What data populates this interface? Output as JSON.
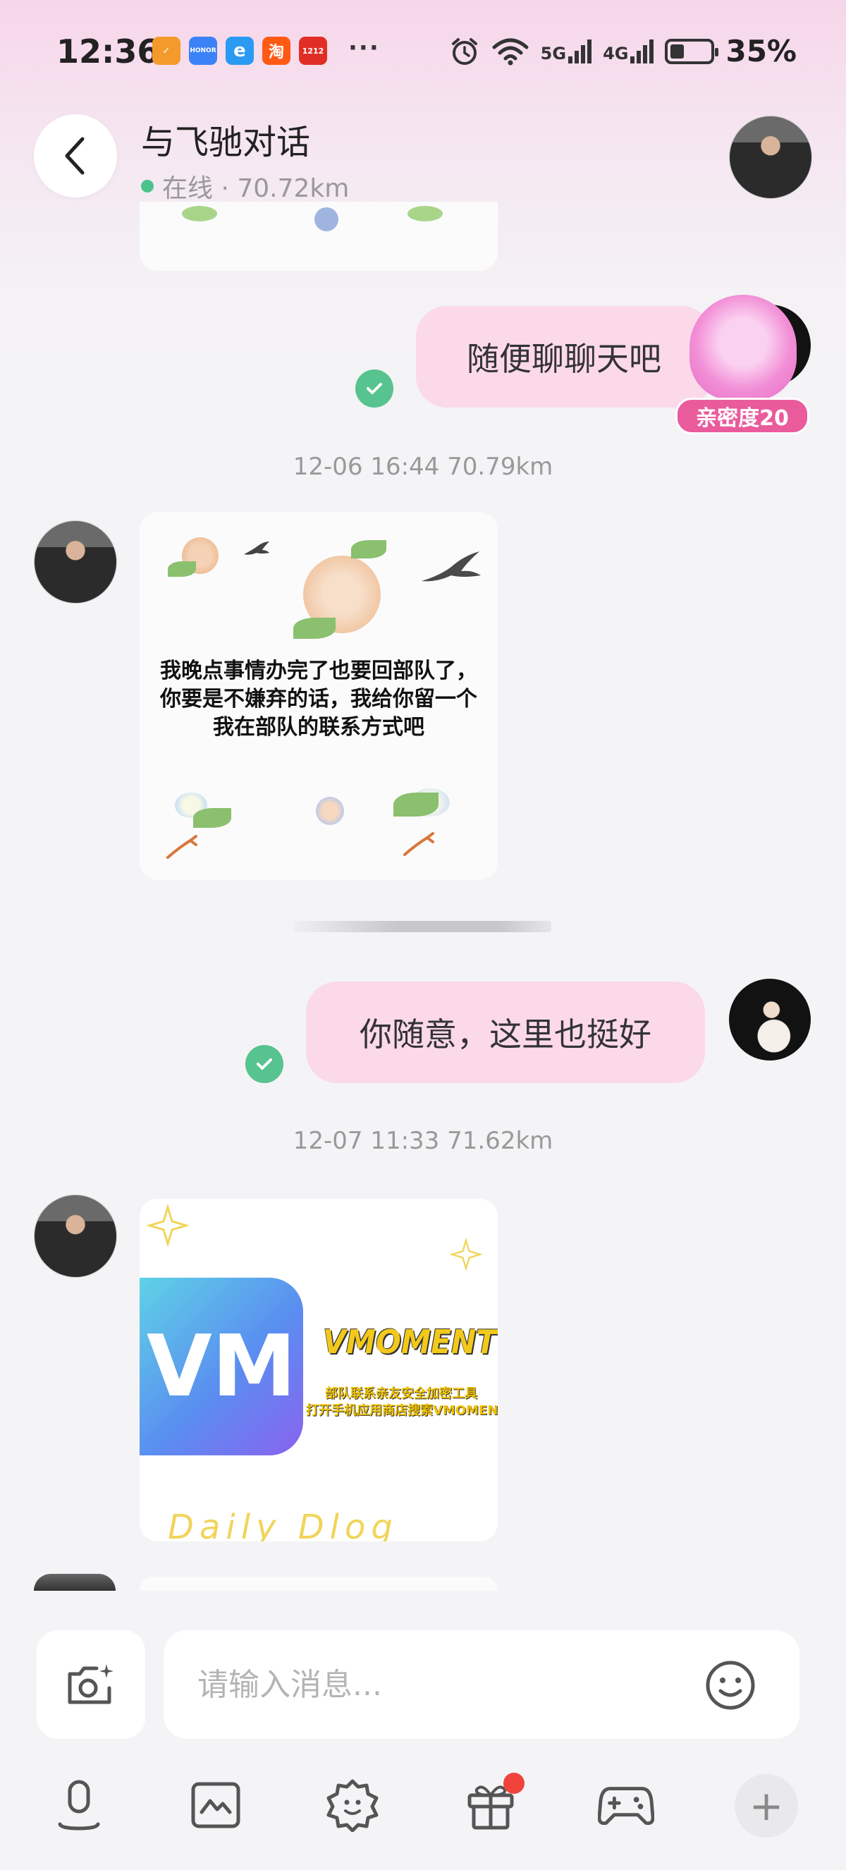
{
  "status_bar": {
    "time": "12:36",
    "apps": [
      {
        "name": "orange-app-icon",
        "label": "✓",
        "color": "#f39a2a"
      },
      {
        "name": "honor-app-icon",
        "label": "HONOR",
        "color": "#3b82f6"
      },
      {
        "name": "e-app-icon",
        "label": "e",
        "color": "#2b9af3"
      },
      {
        "name": "taobao-app-icon",
        "label": "淘",
        "color": "#ff5a14"
      },
      {
        "name": "pinduoduo-app-icon",
        "label": "1212",
        "color": "#e02e24"
      }
    ],
    "more": "···",
    "signal_1": "5G",
    "signal_2": "4G",
    "battery": "35%",
    "battery_level": 0.35
  },
  "header": {
    "title": "与飞驰对话",
    "status": "在线 · 70.72km"
  },
  "messages": {
    "m1_text": "随便聊聊天吧",
    "intimacy": "亲密度20",
    "ts1": "12-06 16:44  70.79km",
    "card_text_1": "我晚点事情办完了也要回部队了，",
    "card_text_2": "你要是不嫌弃的话，我给你留一个",
    "card_text_3": "我在部队的联系方式吧",
    "m2_text": "你随意，这里也挺好",
    "ts2": "12-07 11:33  71.62km",
    "vm_logo": "VM",
    "vm_brand": "VMOMENT",
    "vm_line1": "部队联系亲友安全加密工具",
    "vm_line2": "打开手机应用商店搜索VMOMENT下载",
    "vm_daily": "Daily Dlog"
  },
  "input": {
    "placeholder": "请输入消息..."
  },
  "toolbar": {
    "items": [
      "voice-icon",
      "photo-icon",
      "sticker-icon",
      "gift-icon",
      "game-icon",
      "plus-icon"
    ],
    "plus": "+"
  }
}
